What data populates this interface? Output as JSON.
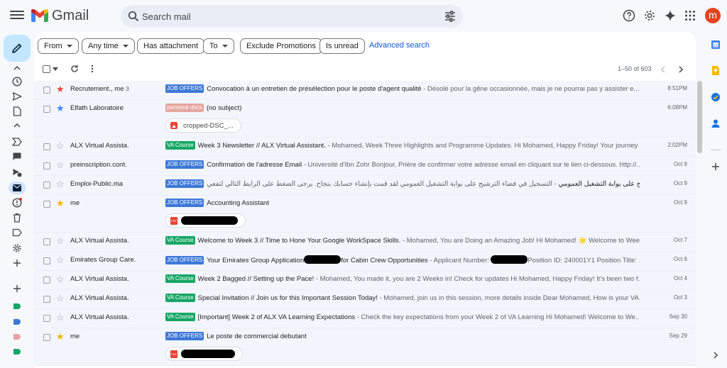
{
  "app": {
    "name": "Gmail"
  },
  "search": {
    "placeholder": "Search mail"
  },
  "user": {
    "avatar_letter": "m"
  },
  "filters": {
    "from": "From",
    "any_time": "Any time",
    "has_attachment": "Has attachment",
    "to": "To",
    "exclude_promotions": "Exclude Promotions",
    "is_unread": "Is unread",
    "advanced_search": "Advanced search"
  },
  "toolbar": {
    "range": "1–50 of 603"
  },
  "colors": {
    "job_offers": "#3c78d8",
    "personal_docs": "#e6a4a0",
    "va_course": "#16a765",
    "star_red": "#e8453c",
    "star_blue": "#4285f4",
    "star_yellow": "#f4b400"
  },
  "emails": [
    {
      "sender": "Recrutement., me",
      "count": "3",
      "star": "red",
      "label": "JOB OFFERS",
      "subject": "Convocation à un entretien de présélection pour le poste d'agent qualité",
      "snippet": " - Désolé pour la gêne occasionnée, mais je ne pourrai pas y assister e...",
      "date": "8:51PM"
    },
    {
      "sender": "Elfath Laboratoire",
      "star": "blue",
      "label": "personal docs",
      "subject": "(no subject)",
      "snippet": "",
      "date": "6:08PM",
      "attachment": "cropped-DSC_..."
    },
    {
      "sender": "ALX Virtual Assista.",
      "star": "none",
      "label": "VA Course",
      "subject": "Week 3 Newsletter // ALX Virtual Assistant.",
      "snippet": " - Mohamed, Week Three Highlights and Programme Updates. Hi Mohamed, Happy Friday! Your journey ...",
      "date": "2:02PM"
    },
    {
      "sender": "preinscription.cont.",
      "star": "none",
      "label": "JOB OFFERS",
      "subject": "Confirmation de l'adresse Email",
      "snippet": " - Université d'Ibn Zohr Bonjour, Prière de confirmer votre adresse email en cliquant sur le lien ci-dessous. http://...",
      "date": "Oct 9"
    },
    {
      "sender": "Emploi-Public.ma",
      "star": "none",
      "label": "JOB OFFERS",
      "subject": "التسجيل في فضاء الترشيح على بوابة التشغيل العمومي",
      "snippet": " - التسجيل في فضاء الترشيح على بوابة التشغيل العمومي لقد قمت بإنشاء حسابك بنجاح. يرجى الضغط على الرابط التالي لتفعي... Emploi-Public.ma",
      "date": "Oct 9"
    },
    {
      "sender": "me",
      "star": "yellow",
      "label": "JOB OFFERS",
      "subject": "Accounting Assistant",
      "snippet": "",
      "date": "Oct 9",
      "attachment": "pdf"
    },
    {
      "sender": "ALX Virtual Assista.",
      "star": "none",
      "label": "VA Course",
      "subject": "Welcome to Week 3 // Time to Hone Your Google WorkSpace Skills.",
      "snippet": " - Mohamed, You are Doing an Amazing Job! Hi Mohamed! 🌟 Welcome to Week ...",
      "date": "Oct 7"
    },
    {
      "sender": "Emirates Group Care.",
      "star": "none",
      "label": "JOB OFFERS",
      "subject_a": "Your Emirates Group Application",
      "subject_b": "for Cabin Crew Opportunities",
      "snippet_a": " - Applicant Number: ",
      "snippet_b": "Position ID: 240001Y1 Position Title: ...",
      "date": "Oct 6"
    },
    {
      "sender": "ALX Virtual Assista.",
      "star": "none",
      "label": "VA Course",
      "subject": "Week 2 Bagged // Setting up the Pace!",
      "snippet": " - Mohamed, You made it, you are 2 Weeks in! Check for updates Hi Mohamed, Happy Friday! It's been two f...",
      "date": "Oct 4"
    },
    {
      "sender": "ALX Virtual Assista.",
      "star": "none",
      "label": "VA Course",
      "subject": "Special Invitation // Join us for this Important Session Today!",
      "snippet": " - Mohamed, join us in this session, more details inside Dear Mohamed, How is your VA...",
      "date": "Oct 3"
    },
    {
      "sender": "ALX Virtual Assista.",
      "star": "none",
      "label": "VA Course",
      "subject": "[Important] Week 2 of ALX VA Learning Expectations",
      "snippet": " - Check the key expectations from your Week 2 of VA Learning Hi Mohamed! Welcome to We...",
      "date": "Sep 30"
    },
    {
      "sender": "me",
      "star": "yellow",
      "label": "JOB OFFERS",
      "subject": "Le poste de commercial debutant",
      "snippet": "",
      "date": "Sep 29",
      "attachment": "pdf"
    }
  ]
}
